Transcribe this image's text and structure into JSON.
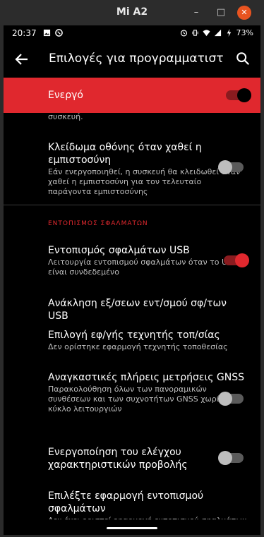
{
  "window": {
    "title": "Mi A2",
    "minimize": "–",
    "maximize": "□",
    "close": "✕"
  },
  "status": {
    "time": "20:37",
    "battery": "73%"
  },
  "appbar": {
    "title": "Επιλογές για προγραμματιστ..."
  },
  "master": {
    "label": "Ενεργό",
    "on": true
  },
  "top_fragment": "συσκευή.",
  "items": [
    {
      "title": "Κλείδωμα οθόνης όταν χαθεί η εμπιστοσύνη",
      "subtitle": "Εάν ενεργοποιηθεί, η συσκευή θα κλειδωθεί όταν χαθεί η εμπιστοσύνη για τον τελευταίο παράγοντα εμπιστοσύνης",
      "toggle": "off"
    },
    {
      "title": "Εντοπισμός σφαλμάτων USB",
      "subtitle": "Λειτουργία εντοπισμού σφαλμάτων όταν το USB είναι συνδεδεμένο",
      "toggle": "on"
    },
    {
      "title": "Ανάκληση εξ/σεων εντ/σμού σφ/των USB",
      "subtitle": ""
    },
    {
      "title": "Επιλογή εφ/γής τεχνητής τοπ/σίας",
      "subtitle": "Δεν ορίστηκε εφαρμογή τεχνητής τοποθεσίας"
    },
    {
      "title": "Αναγκαστικές πλήρεις μετρήσεις GNSS",
      "subtitle": "Παρακολούθηση όλων των πανοραμικών συνθέσεων και των συχνοτήτων GNSS χωρίς κύκλο λειτουργιών",
      "toggle": "off"
    },
    {
      "title": "Ενεργοποίηση του ελέγχου χαρακτηριστικών προβολής",
      "subtitle": "",
      "toggle": "off"
    },
    {
      "title": "Επιλέξτε εφαρμογή εντοπισμού σφαλμάτων",
      "subtitle": "Δεν έχει οριστεί εφαρμογή εντοπισμού σφαλμάτων"
    }
  ],
  "section": {
    "debugging": "ΕΝΤΟΠΙΣΜΟΣ ΣΦΑΛΜΑΤΩΝ"
  },
  "colors": {
    "accent": "#e0282e",
    "background": "#000000"
  }
}
